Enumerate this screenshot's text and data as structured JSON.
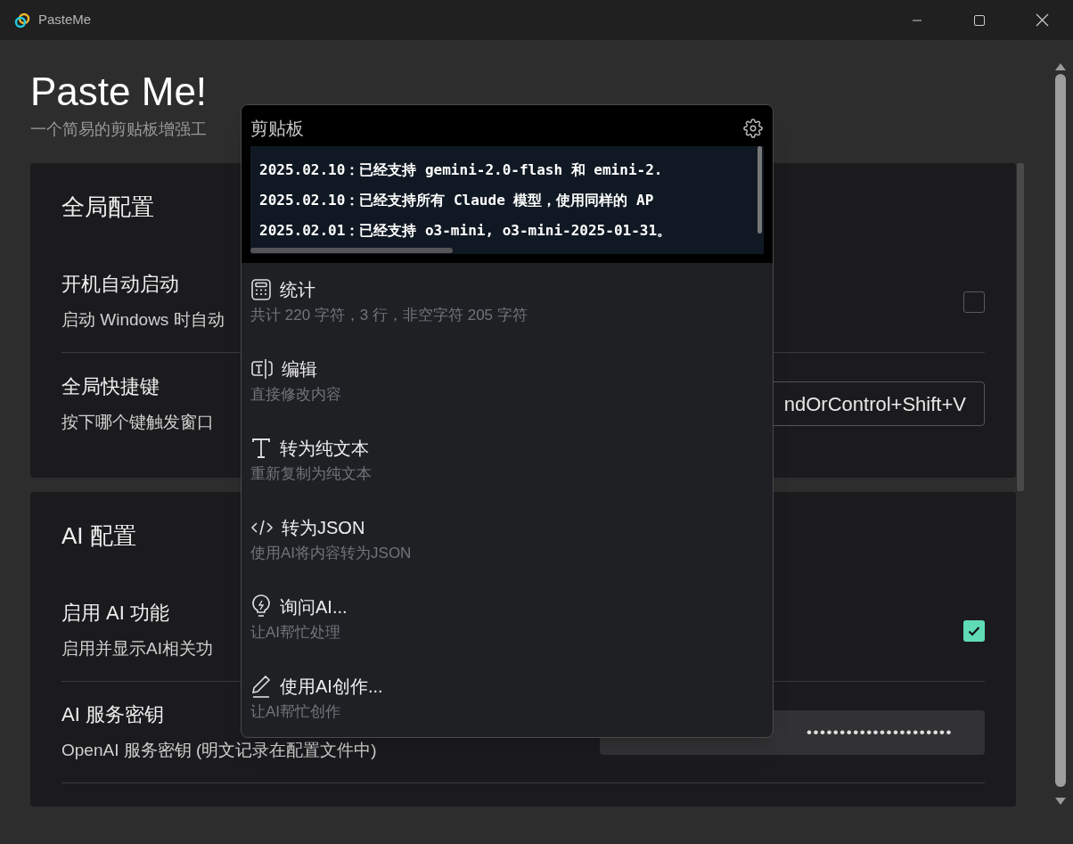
{
  "window": {
    "title": "PasteMe"
  },
  "header": {
    "title": "Paste Me!",
    "subtitle": "一个简易的剪贴板增强工"
  },
  "sections": [
    {
      "title": "全局配置",
      "rows": [
        {
          "kind": "checkbox",
          "label": "开机自动启动",
          "description": "启动 Windows 时自动",
          "checked": false
        },
        {
          "kind": "text_field",
          "label": "全局快捷键",
          "description": "按下哪个键触发窗口",
          "value": "ndOrControl+Shift+V"
        }
      ]
    },
    {
      "title": "AI 配置",
      "rows": [
        {
          "kind": "checkbox",
          "label": "启用 AI 功能",
          "description": "启用并显示AI相关功",
          "checked": true
        },
        {
          "kind": "password_field",
          "label": "AI 服务密钥",
          "description": "OpenAI 服务密钥 (明文记录在配置文件中)",
          "value": "••••••••••••••••••••••"
        }
      ]
    }
  ],
  "popup": {
    "title": "剪贴板",
    "clipboard_lines": [
      "2025.02.10：已经支持 gemini-2.0-flash 和 emini-2.",
      "2025.02.10：已经支持所有 Claude 模型，使用同样的 AP",
      "2025.02.01：已经支持 o3-mini, o3-mini-2025-01-31。"
    ],
    "actions": [
      {
        "kind": "calculator",
        "title": "统计",
        "description": "共计 220 字符，3 行，非空字符 205 字符"
      },
      {
        "kind": "text-edit",
        "title": "编辑",
        "description": "直接修改内容"
      },
      {
        "kind": "text",
        "title": "转为纯文本",
        "description": "重新复制为纯文本"
      },
      {
        "kind": "code",
        "title": "转为JSON",
        "description": "使用AI将内容转为JSON"
      },
      {
        "kind": "lightbulb",
        "title": "询问AI...",
        "description": "让AI帮忙处理"
      },
      {
        "kind": "pencil",
        "title": "使用AI创作...",
        "description": "让AI帮忙创作"
      }
    ]
  }
}
